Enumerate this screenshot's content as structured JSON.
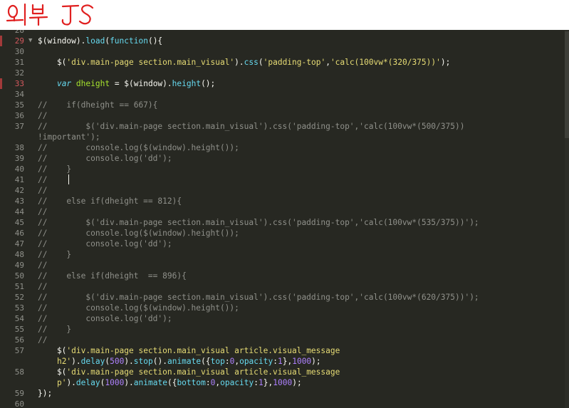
{
  "annotation": {
    "text": "외부 JS"
  },
  "lines": [
    {
      "num": "28",
      "err": false,
      "fold": false,
      "parts": [
        {
          "t": "",
          "c": "p"
        }
      ]
    },
    {
      "num": "29",
      "err": true,
      "fold": true,
      "parts": [
        {
          "t": "$(window).",
          "c": "p"
        },
        {
          "t": "load",
          "c": "f"
        },
        {
          "t": "(",
          "c": "p"
        },
        {
          "t": "function",
          "c": "f"
        },
        {
          "t": "(){",
          "c": "p"
        }
      ]
    },
    {
      "num": "30",
      "err": false,
      "fold": false,
      "parts": []
    },
    {
      "num": "31",
      "err": false,
      "fold": false,
      "parts": [
        {
          "t": "    $(",
          "c": "p"
        },
        {
          "t": "'div.main-page section.main_visual'",
          "c": "s"
        },
        {
          "t": ").",
          "c": "p"
        },
        {
          "t": "css",
          "c": "f"
        },
        {
          "t": "(",
          "c": "p"
        },
        {
          "t": "'padding-top'",
          "c": "s"
        },
        {
          "t": ",",
          "c": "p"
        },
        {
          "t": "'calc(100vw*(320/375))'",
          "c": "s"
        },
        {
          "t": ");",
          "c": "p"
        }
      ]
    },
    {
      "num": "32",
      "err": false,
      "fold": false,
      "parts": []
    },
    {
      "num": "33",
      "err": true,
      "fold": false,
      "parts": [
        {
          "t": "    ",
          "c": "p"
        },
        {
          "t": "var",
          "c": "k"
        },
        {
          "t": " ",
          "c": "p"
        },
        {
          "t": "dheight",
          "c": "v"
        },
        {
          "t": " = $(window).",
          "c": "p"
        },
        {
          "t": "height",
          "c": "f"
        },
        {
          "t": "();",
          "c": "p"
        }
      ]
    },
    {
      "num": "34",
      "err": false,
      "fold": false,
      "parts": []
    },
    {
      "num": "35",
      "err": false,
      "fold": false,
      "parts": [
        {
          "t": "//    if(dheight == 667){",
          "c": "cm"
        }
      ]
    },
    {
      "num": "36",
      "err": false,
      "fold": false,
      "parts": [
        {
          "t": "//",
          "c": "cm"
        }
      ]
    },
    {
      "num": "37",
      "err": false,
      "fold": false,
      "parts": [
        {
          "t": "//        $('div.main-page section.main_visual').css('padding-top','calc(100vw*(500/375))",
          "c": "cm"
        }
      ]
    },
    {
      "num": "",
      "err": false,
      "fold": false,
      "parts": [
        {
          "t": "!important');",
          "c": "cm"
        }
      ],
      "wrap": true
    },
    {
      "num": "38",
      "err": false,
      "fold": false,
      "parts": [
        {
          "t": "//        console.log($(window).height());",
          "c": "cm"
        }
      ]
    },
    {
      "num": "39",
      "err": false,
      "fold": false,
      "parts": [
        {
          "t": "//        console.log('dd');",
          "c": "cm"
        }
      ]
    },
    {
      "num": "40",
      "err": false,
      "fold": false,
      "parts": [
        {
          "t": "//    }",
          "c": "cm"
        }
      ]
    },
    {
      "num": "41",
      "err": false,
      "fold": false,
      "parts": [
        {
          "t": "//",
          "c": "cm"
        }
      ],
      "cursor": true
    },
    {
      "num": "42",
      "err": false,
      "fold": false,
      "parts": [
        {
          "t": "//",
          "c": "cm"
        }
      ]
    },
    {
      "num": "43",
      "err": false,
      "fold": false,
      "parts": [
        {
          "t": "//    else if(dheight == 812){",
          "c": "cm"
        }
      ]
    },
    {
      "num": "44",
      "err": false,
      "fold": false,
      "parts": [
        {
          "t": "//",
          "c": "cm"
        }
      ]
    },
    {
      "num": "45",
      "err": false,
      "fold": false,
      "parts": [
        {
          "t": "//        $('div.main-page section.main_visual').css('padding-top','calc(100vw*(535/375))');",
          "c": "cm"
        }
      ]
    },
    {
      "num": "46",
      "err": false,
      "fold": false,
      "parts": [
        {
          "t": "//        console.log($(window).height());",
          "c": "cm"
        }
      ]
    },
    {
      "num": "47",
      "err": false,
      "fold": false,
      "parts": [
        {
          "t": "//        console.log('dd');",
          "c": "cm"
        }
      ]
    },
    {
      "num": "48",
      "err": false,
      "fold": false,
      "parts": [
        {
          "t": "//    }",
          "c": "cm"
        }
      ]
    },
    {
      "num": "49",
      "err": false,
      "fold": false,
      "parts": [
        {
          "t": "//",
          "c": "cm"
        }
      ]
    },
    {
      "num": "50",
      "err": false,
      "fold": false,
      "parts": [
        {
          "t": "//    else if(dheight  == 896){",
          "c": "cm"
        }
      ]
    },
    {
      "num": "51",
      "err": false,
      "fold": false,
      "parts": [
        {
          "t": "//",
          "c": "cm"
        }
      ]
    },
    {
      "num": "52",
      "err": false,
      "fold": false,
      "parts": [
        {
          "t": "//        $('div.main-page section.main_visual').css('padding-top','calc(100vw*(620/375))');",
          "c": "cm"
        }
      ]
    },
    {
      "num": "53",
      "err": false,
      "fold": false,
      "parts": [
        {
          "t": "//        console.log($(window).height());",
          "c": "cm"
        }
      ]
    },
    {
      "num": "54",
      "err": false,
      "fold": false,
      "parts": [
        {
          "t": "//        console.log('dd');",
          "c": "cm"
        }
      ]
    },
    {
      "num": "55",
      "err": false,
      "fold": false,
      "parts": [
        {
          "t": "//    }",
          "c": "cm"
        }
      ]
    },
    {
      "num": "56",
      "err": false,
      "fold": false,
      "parts": [
        {
          "t": "//",
          "c": "cm"
        }
      ]
    },
    {
      "num": "57",
      "err": false,
      "fold": false,
      "parts": [
        {
          "t": "    $(",
          "c": "p"
        },
        {
          "t": "'div.main-page section.main_visual article.visual_message",
          "c": "s"
        }
      ]
    },
    {
      "num": "",
      "err": false,
      "fold": false,
      "wrap": true,
      "parts": [
        {
          "t": "    ",
          "c": "p"
        },
        {
          "t": "h2'",
          "c": "s"
        },
        {
          "t": ").",
          "c": "p"
        },
        {
          "t": "delay",
          "c": "f"
        },
        {
          "t": "(",
          "c": "p"
        },
        {
          "t": "500",
          "c": "n"
        },
        {
          "t": ").",
          "c": "p"
        },
        {
          "t": "stop",
          "c": "f"
        },
        {
          "t": "().",
          "c": "p"
        },
        {
          "t": "animate",
          "c": "f"
        },
        {
          "t": "({",
          "c": "p"
        },
        {
          "t": "top",
          "c": "f"
        },
        {
          "t": ":",
          "c": "p"
        },
        {
          "t": "0",
          "c": "n"
        },
        {
          "t": ",",
          "c": "p"
        },
        {
          "t": "opacity",
          "c": "f"
        },
        {
          "t": ":",
          "c": "p"
        },
        {
          "t": "1",
          "c": "n"
        },
        {
          "t": "},",
          "c": "p"
        },
        {
          "t": "1000",
          "c": "n"
        },
        {
          "t": ");",
          "c": "p"
        }
      ]
    },
    {
      "num": "58",
      "err": false,
      "fold": false,
      "parts": [
        {
          "t": "    $(",
          "c": "p"
        },
        {
          "t": "'div.main-page section.main_visual article.visual_message",
          "c": "s"
        }
      ]
    },
    {
      "num": "",
      "err": false,
      "fold": false,
      "wrap": true,
      "parts": [
        {
          "t": "    ",
          "c": "p"
        },
        {
          "t": "p'",
          "c": "s"
        },
        {
          "t": ").",
          "c": "p"
        },
        {
          "t": "delay",
          "c": "f"
        },
        {
          "t": "(",
          "c": "p"
        },
        {
          "t": "1000",
          "c": "n"
        },
        {
          "t": ").",
          "c": "p"
        },
        {
          "t": "animate",
          "c": "f"
        },
        {
          "t": "({",
          "c": "p"
        },
        {
          "t": "bottom",
          "c": "f"
        },
        {
          "t": ":",
          "c": "p"
        },
        {
          "t": "0",
          "c": "n"
        },
        {
          "t": ",",
          "c": "p"
        },
        {
          "t": "opacity",
          "c": "f"
        },
        {
          "t": ":",
          "c": "p"
        },
        {
          "t": "1",
          "c": "n"
        },
        {
          "t": "},",
          "c": "p"
        },
        {
          "t": "1000",
          "c": "n"
        },
        {
          "t": ");",
          "c": "p"
        }
      ]
    },
    {
      "num": "59",
      "err": false,
      "fold": false,
      "parts": [
        {
          "t": "});",
          "c": "p"
        }
      ]
    },
    {
      "num": "60",
      "err": false,
      "fold": false,
      "parts": []
    }
  ]
}
